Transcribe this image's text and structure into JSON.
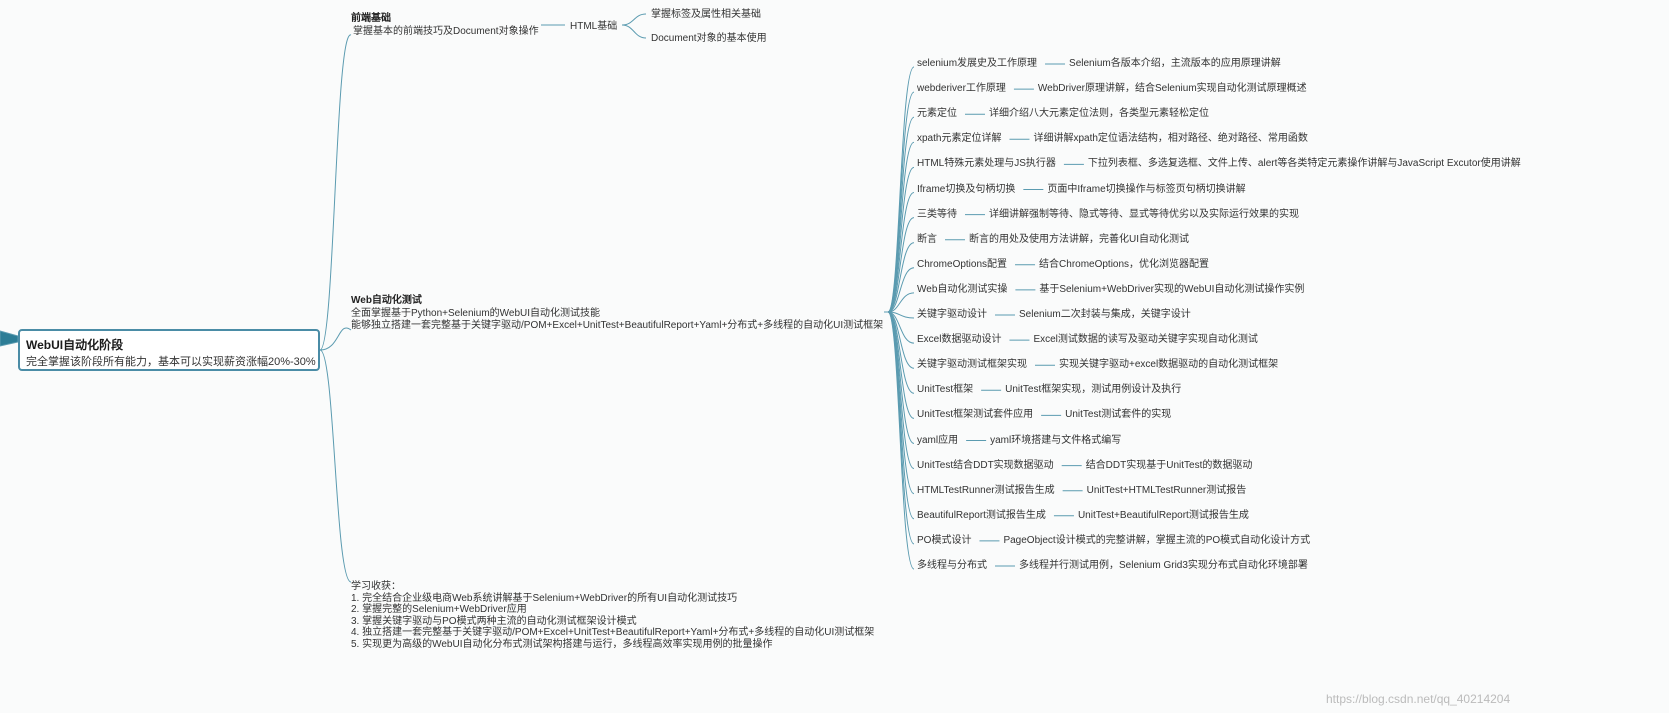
{
  "root": {
    "title": "WebUI自动化阶段",
    "subtitle": "完全掌握该阶段所有能力，基本可以实现薪资涨幅20%-30%"
  },
  "frontend": {
    "title": "前端基础",
    "desc": "掌握基本的前端技巧及Document对象操作",
    "html": "HTML基础",
    "children": [
      "掌握标签及属性相关基础",
      "Document对象的基本使用"
    ]
  },
  "web": {
    "title": "Web自动化测试",
    "line1": "全面掌握基于Python+Selenium的WebUI自动化测试技能",
    "line2": "能够独立搭建一套完整基于关键字驱动/POM+Excel+UnitTest+BeautifulReport+Yaml+分布式+多线程的自动化UI测试框架",
    "items": [
      {
        "label": "selenium发展史及工作原理",
        "desc": "Selenium各版本介绍，主流版本的应用原理讲解"
      },
      {
        "label": "webderiver工作原理",
        "desc": "WebDriver原理讲解，结合Selenium实现自动化测试原理概述"
      },
      {
        "label": "元素定位",
        "desc": "详细介绍八大元素定位法则，各类型元素轻松定位"
      },
      {
        "label": "xpath元素定位详解",
        "desc": "详细讲解xpath定位语法结构，相对路径、绝对路径、常用函数"
      },
      {
        "label": "HTML特殊元素处理与JS执行器",
        "desc": "下拉列表框、多选复选框、文件上传、alert等各类特定元素操作讲解与JavaScript Excutor使用讲解"
      },
      {
        "label": "Iframe切换及句柄切换",
        "desc": "页面中Iframe切换操作与标签页句柄切换讲解"
      },
      {
        "label": "三类等待",
        "desc": "详细讲解强制等待、隐式等待、显式等待优劣以及实际运行效果的实现"
      },
      {
        "label": "断言",
        "desc": "断言的用处及使用方法讲解，完善化UI自动化测试"
      },
      {
        "label": "ChromeOptions配置",
        "desc": "结合ChromeOptions，优化浏览器配置"
      },
      {
        "label": "Web自动化测试实操",
        "desc": "基于Selenium+WebDriver实现的WebUI自动化测试操作实例"
      },
      {
        "label": "关键字驱动设计",
        "desc": "Selenium二次封装与集成，关键字设计"
      },
      {
        "label": "Excel数据驱动设计",
        "desc": "Excel测试数据的读写及驱动关键字实现自动化测试"
      },
      {
        "label": "关键字驱动测试框架实现",
        "desc": "实现关键字驱动+excel数据驱动的自动化测试框架"
      },
      {
        "label": "UnitTest框架",
        "desc": "UnitTest框架实现，测试用例设计及执行"
      },
      {
        "label": "UnitTest框架测试套件应用",
        "desc": "UnitTest测试套件的实现"
      },
      {
        "label": "yaml应用",
        "desc": "yaml环境搭建与文件格式编写"
      },
      {
        "label": "UnitTest结合DDT实现数据驱动",
        "desc": "结合DDT实现基于UnitTest的数据驱动"
      },
      {
        "label": "HTMLTestRunner测试报告生成",
        "desc": "UnitTest+HTMLTestRunner测试报告"
      },
      {
        "label": "BeautifulReport测试报告生成",
        "desc": "UnitTest+BeautifulReport测试报告生成"
      },
      {
        "label": "PO模式设计",
        "desc": "PageObject设计模式的完整讲解，掌握主流的PO模式自动化设计方式"
      },
      {
        "label": "多线程与分布式",
        "desc": "多线程并行测试用例，Selenium Grid3实现分布式自动化环境部署"
      }
    ]
  },
  "gains": {
    "title": "学习收获：",
    "lines": [
      "1. 完全结合企业级电商Web系统讲解基于Selenium+WebDriver的所有UI自动化测试技巧",
      "2. 掌握完整的Selenium+WebDriver应用",
      "3. 掌握关键字驱动与PO模式两种主流的自动化测试框架设计模式",
      "4. 独立搭建一套完整基于关键字驱动/POM+Excel+UnitTest+BeautifulReport+Yaml+分布式+多线程的自动化UI测试框架",
      "5. 实现更为高级的WebUI自动化分布式测试架构搭建与运行，多线程高效率实现用例的批量操作"
    ]
  },
  "watermark": "https://blog.csdn.net/qq_40214204",
  "colors": {
    "line": "#5b9bb0",
    "root_border": "#4a8ca6"
  }
}
